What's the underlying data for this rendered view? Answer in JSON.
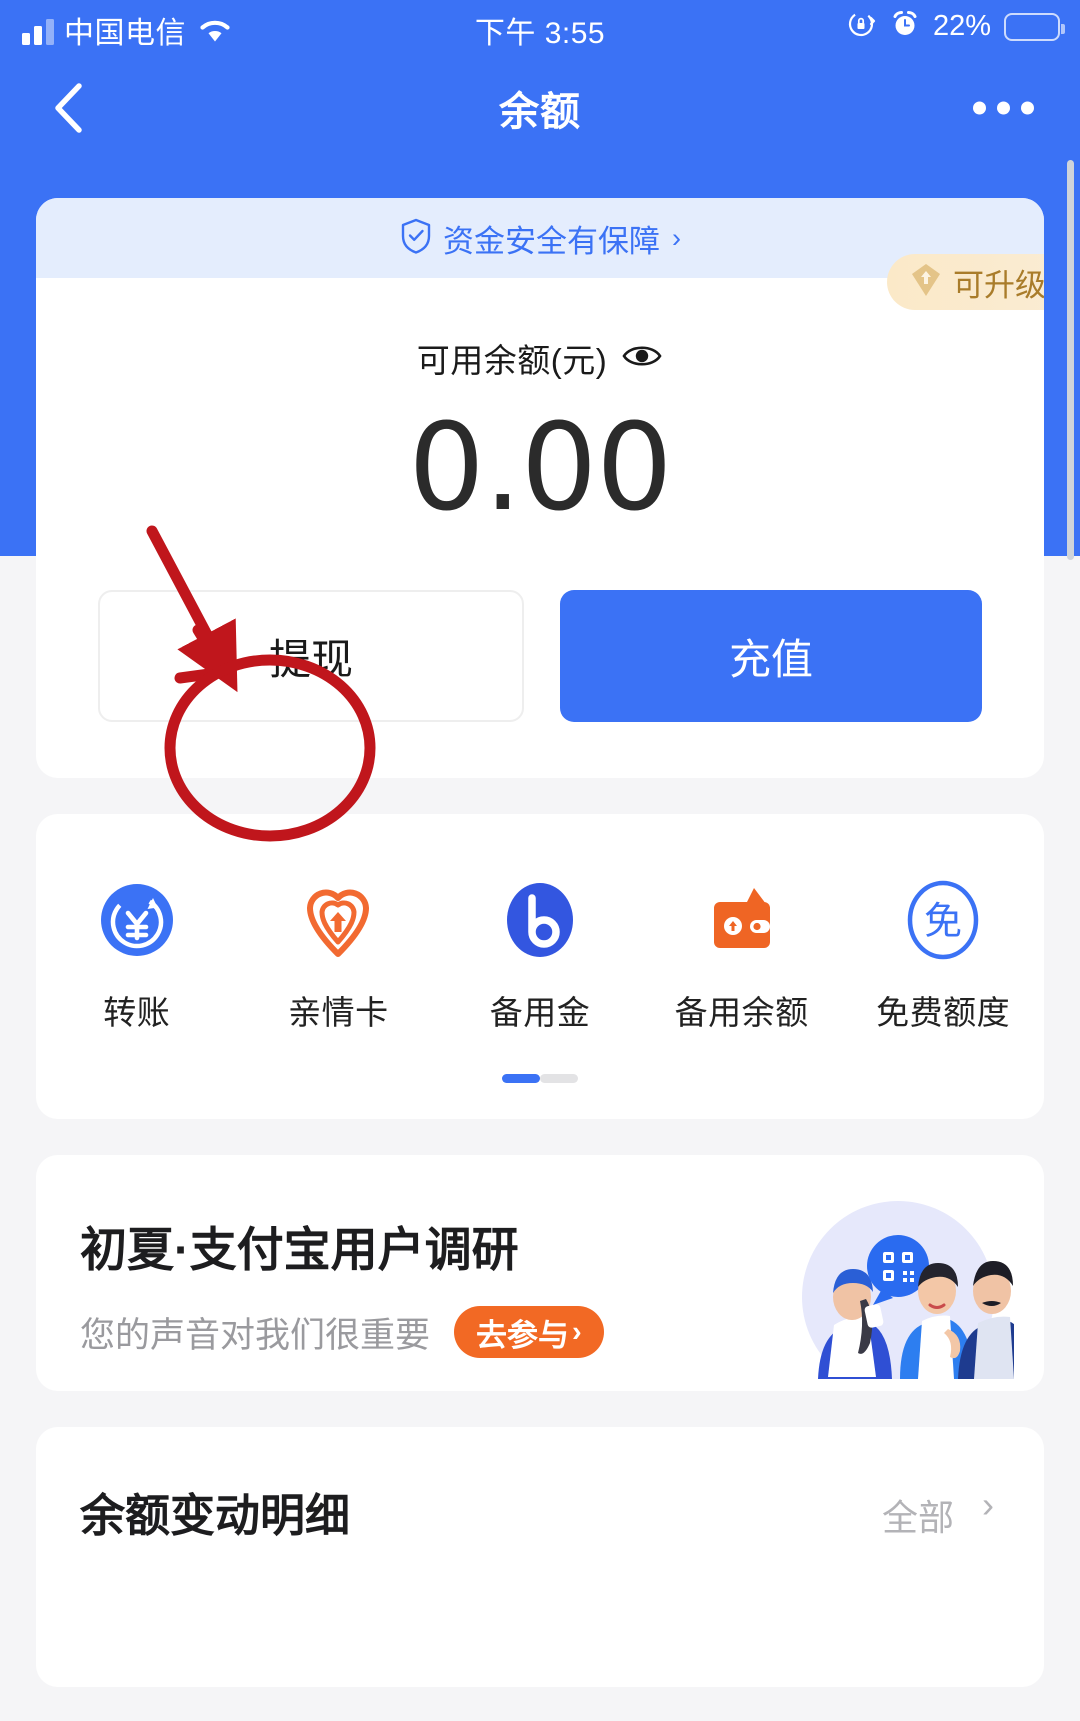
{
  "status_bar": {
    "carrier": "中国电信",
    "signal_icon": "signal-bars-icon",
    "wifi_icon": "wifi-icon",
    "time": "下午 3:55",
    "rotation_lock_icon": "rotation-lock-icon",
    "alarm_icon": "alarm-clock-icon",
    "battery_percent": "22%",
    "battery_fill_color": "#f5c832",
    "battery_level": 22
  },
  "nav": {
    "back_icon": "back-chevron-icon",
    "title": "余额",
    "more_icon": "more-dots-icon"
  },
  "balance_card": {
    "safety_icon": "shield-check-icon",
    "safety_text": "资金安全有保障",
    "safety_chevron": "›",
    "label": "可用余额(元)",
    "eye_icon": "eye-icon",
    "amount": "0.00",
    "upgrade_badge": {
      "icon": "diamond-upgrade-icon",
      "text": "可升级"
    },
    "withdraw_label": "提现",
    "recharge_label": "充值"
  },
  "quick_actions": {
    "items": [
      {
        "label": "转账",
        "icon": "transfer-yuan-icon",
        "color": "#3b72f5"
      },
      {
        "label": "亲情卡",
        "icon": "family-heart-icon",
        "color": "#f26a31"
      },
      {
        "label": "备用金",
        "icon": "beiyongjin-b-icon",
        "color": "#3356e0"
      },
      {
        "label": "备用余额",
        "icon": "wallet-icon",
        "color": "#ef6524"
      },
      {
        "label": "免费额度",
        "icon": "free-quota-icon",
        "color": "#3b72f5"
      }
    ],
    "pagination": {
      "active_index": 0,
      "count": 2
    }
  },
  "survey_banner": {
    "title": "初夏·支付宝用户调研",
    "subtitle": "您的声音对我们很重要",
    "cta_label": "去参与",
    "cta_chevron": "›",
    "cta_color": "#f26924",
    "illustration": "three-people-qr-illustration"
  },
  "detail_section": {
    "title": "余额变动明细",
    "all_label": "全部",
    "all_chevron": "›"
  },
  "annotation": {
    "arrow_color": "#c0161c",
    "circle_color": "#c0161c",
    "target": "提现"
  },
  "colors": {
    "brand_blue": "#3b72f5",
    "page_bg": "#f5f5f7",
    "card_bg": "#ffffff"
  }
}
